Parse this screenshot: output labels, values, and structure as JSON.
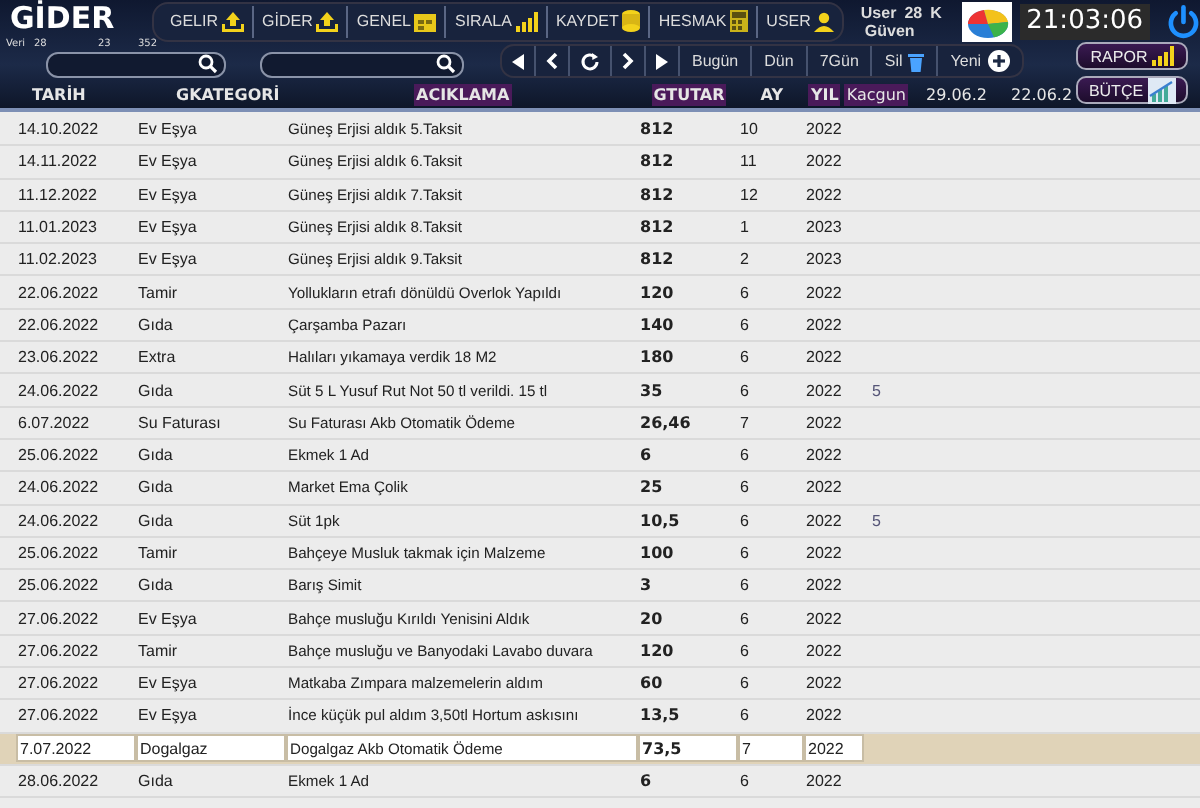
{
  "app": {
    "title": "GİDER",
    "stats": [
      "Veri",
      "28",
      "23",
      "352"
    ]
  },
  "nav": [
    {
      "label": "GELIR",
      "kind": "upload"
    },
    {
      "label": "GİDER",
      "kind": "upload"
    },
    {
      "label": "GENEL",
      "kind": "calendar"
    },
    {
      "label": "SIRALA",
      "kind": "bars"
    },
    {
      "label": "KAYDET",
      "kind": "coins"
    },
    {
      "label": "HESMAK",
      "kind": "calculator"
    },
    {
      "label": "USER",
      "kind": "user"
    }
  ],
  "user": {
    "label": "User",
    "count": "28",
    "extra": "K",
    "name": "Güven"
  },
  "clock": "21:03:06",
  "date_buttons": [
    "Bugün",
    "Dün",
    "7Gün"
  ],
  "actions": [
    {
      "label": "Sil",
      "kind": "trash"
    },
    {
      "label": "Yeni",
      "kind": "plus"
    }
  ],
  "side_buttons": [
    {
      "label": "RAPOR",
      "kind": "bars"
    },
    {
      "label": "BÜTÇE",
      "kind": "chart"
    }
  ],
  "columns": [
    {
      "label": "TARİH",
      "highlighted": false
    },
    {
      "label": "GKATEGORİ",
      "highlighted": false
    },
    {
      "label": "ACIKLAMA",
      "highlighted": true
    },
    {
      "label": "GTUTAR",
      "highlighted": true
    },
    {
      "label": "AY",
      "highlighted": false
    },
    {
      "label": "YIL",
      "highlighted": true
    },
    {
      "label": "Kacgun",
      "highlighted": true
    },
    {
      "label": "29.06.2",
      "highlighted": false
    },
    {
      "label": "22.06.2",
      "highlighted": false
    }
  ],
  "rows": [
    {
      "date": "14.10.2022",
      "category": "Ev Eşya",
      "description": "Güneş Erjisi aldık 5.Taksit",
      "amount": "812",
      "month": "10",
      "year": "2022",
      "selected": false
    },
    {
      "date": "14.11.2022",
      "category": "Ev Eşya",
      "description": "Güneş Erjisi aldık 6.Taksit",
      "amount": "812",
      "month": "11",
      "year": "2022",
      "selected": false
    },
    {
      "date": "11.12.2022",
      "category": "Ev Eşya",
      "description": "Güneş Erjisi aldık 7.Taksit",
      "amount": "812",
      "month": "12",
      "year": "2022",
      "selected": false
    },
    {
      "date": "11.01.2023",
      "category": "Ev Eşya",
      "description": "Güneş Erjisi aldık 8.Taksit",
      "amount": "812",
      "month": "1",
      "year": "2023",
      "selected": false
    },
    {
      "date": "11.02.2023",
      "category": "Ev Eşya",
      "description": "Güneş Erjisi aldık 9.Taksit",
      "amount": "812",
      "month": "2",
      "year": "2023",
      "selected": false
    },
    {
      "date": "22.06.2022",
      "category": "Tamir",
      "description": "Yollukların etrafı dönüldü Overlok Yapıldı",
      "amount": "120",
      "month": "6",
      "year": "2022",
      "selected": false
    },
    {
      "date": "22.06.2022",
      "category": "Gıda",
      "description": "Çarşamba Pazarı",
      "amount": "140",
      "month": "6",
      "year": "2022",
      "selected": false
    },
    {
      "date": "23.06.2022",
      "category": "Extra",
      "description": "Halıları yıkamaya verdik 18 M2",
      "amount": "180",
      "month": "6",
      "year": "2022",
      "selected": false
    },
    {
      "date": "24.06.2022",
      "category": "Gıda",
      "description": "Süt 5 L Yusuf Rut Not 50 tl verildi. 15 tl",
      "amount": "35",
      "month": "6",
      "year": "2022",
      "extra": "5",
      "selected": false
    },
    {
      "date": "6.07.2022",
      "category": "Su Faturası",
      "description": "Su Faturası Akb Otomatik Ödeme",
      "amount": "26,46",
      "month": "7",
      "year": "2022",
      "selected": false
    },
    {
      "date": "25.06.2022",
      "category": "Gıda",
      "description": "Ekmek 1 Ad",
      "amount": "6",
      "month": "6",
      "year": "2022",
      "selected": false
    },
    {
      "date": "24.06.2022",
      "category": "Gıda",
      "description": "Market Ema Çolik",
      "amount": "25",
      "month": "6",
      "year": "2022",
      "selected": false
    },
    {
      "date": "24.06.2022",
      "category": "Gıda",
      "description": "Süt 1pk",
      "amount": "10,5",
      "month": "6",
      "year": "2022",
      "extra": "5",
      "selected": false
    },
    {
      "date": "25.06.2022",
      "category": "Tamir",
      "description": "Bahçeye Musluk takmak için Malzeme",
      "amount": "100",
      "month": "6",
      "year": "2022",
      "selected": false
    },
    {
      "date": "25.06.2022",
      "category": "Gıda",
      "description": "Barış Simit",
      "amount": "3",
      "month": "6",
      "year": "2022",
      "selected": false
    },
    {
      "date": "27.06.2022",
      "category": "Ev Eşya",
      "description": "Bahçe musluğu Kırıldı Yenisini Aldık",
      "amount": "20",
      "month": "6",
      "year": "2022",
      "selected": false
    },
    {
      "date": "27.06.2022",
      "category": "Tamir",
      "description": "Bahçe musluğu ve Banyodaki Lavabo duvara",
      "amount": "120",
      "month": "6",
      "year": "2022",
      "selected": false
    },
    {
      "date": "27.06.2022",
      "category": "Ev Eşya",
      "description": "Matkaba Zımpara malzemelerin aldım",
      "amount": "60",
      "month": "6",
      "year": "2022",
      "selected": false
    },
    {
      "date": "27.06.2022",
      "category": "Ev Eşya",
      "description": "İnce küçük pul aldım 3,50tl Hortum askısını",
      "amount": "13,5",
      "month": "6",
      "year": "2022",
      "selected": false
    },
    {
      "date": "7.07.2022",
      "category": "Dogalgaz",
      "description": "Dogalgaz Akb Otomatik Ödeme",
      "amount": "73,5",
      "month": "7",
      "year": "2022",
      "selected": true
    },
    {
      "date": "28.06.2022",
      "category": "Gıda",
      "description": "Ekmek 1 Ad",
      "amount": "6",
      "month": "6",
      "year": "2022",
      "selected": false
    }
  ]
}
